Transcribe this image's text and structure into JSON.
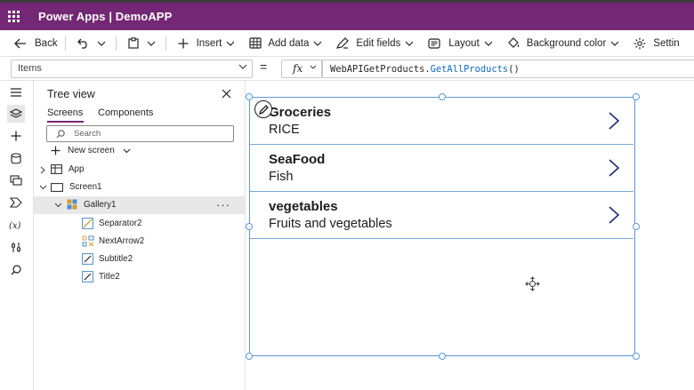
{
  "titlebar": {
    "app_title": "Power Apps  |  DemoAPP"
  },
  "toolbar": {
    "back": "Back",
    "insert": "Insert",
    "add_data": "Add data",
    "edit_fields": "Edit fields",
    "layout": "Layout",
    "background_color": "Background color",
    "settings": "Settin"
  },
  "formula_bar": {
    "property": "Items",
    "equals": "=",
    "fx": "fx",
    "formula_prefix": "WebAPIGetProducts.",
    "formula_function": "GetAllProducts",
    "formula_suffix": "()"
  },
  "tree_view": {
    "title": "Tree view",
    "tabs": {
      "screens": "Screens",
      "components": "Components"
    },
    "search_placeholder": "Search",
    "new_screen": "New screen",
    "nodes": {
      "app": "App",
      "screen1": "Screen1",
      "gallery1": "Gallery1",
      "more": "···",
      "separator2": "Separator2",
      "nextarrow2": "NextArrow2",
      "subtitle2": "Subtitle2",
      "title2": "Title2"
    }
  },
  "gallery": {
    "items": [
      {
        "title": "Groceries",
        "subtitle": "RICE"
      },
      {
        "title": "SeaFood",
        "subtitle": "Fish"
      },
      {
        "title": "vegetables",
        "subtitle": "Fruits and vegetables"
      }
    ]
  },
  "colors": {
    "header_purple": "#742774",
    "selection_blue": "#5b9bd5",
    "formula_function_blue": "#0f6cbd"
  },
  "icons": {
    "app_launcher": "waffle-icon",
    "back": "arrow-left-icon",
    "undo": "undo-icon",
    "paste": "clipboard-icon",
    "insert": "plus-icon",
    "add_data": "database-icon",
    "edit_fields": "pen-icon",
    "layout": "layout-icon",
    "background_color": "paint-bucket-icon",
    "settings": "gear-icon",
    "gallery_next": "chevron-right-icon"
  }
}
